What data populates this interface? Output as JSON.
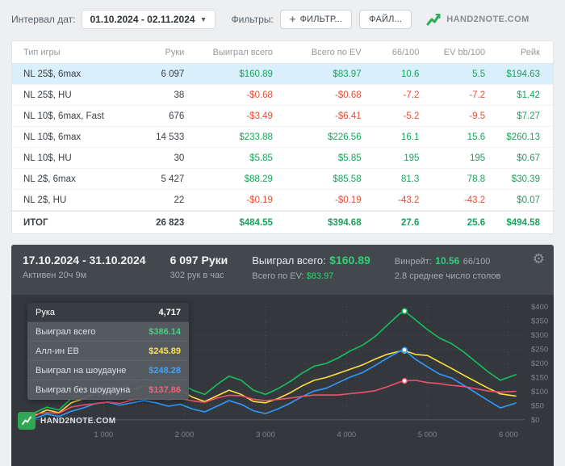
{
  "toolbar": {
    "date_label": "Интервал дат:",
    "date_value": "01.10.2024 - 02.11.2024",
    "filters_label": "Фильтры:",
    "filter_button": "ФИЛЬТР...",
    "file_button": "ФАЙЛ...",
    "brand": "HAND2NOTE.COM"
  },
  "table": {
    "headers": [
      "Тип игры",
      "Руки",
      "Выиграл всего",
      "Всего по EV",
      "66/100",
      "EV bb/100",
      "Рейк"
    ],
    "rows": [
      {
        "cells": [
          "NL 25$, 6max",
          "6 097",
          "$160.89",
          "$83.97",
          "10.6",
          "5.5",
          "$194.63"
        ],
        "selected": true,
        "total": false
      },
      {
        "cells": [
          "NL 25$, HU",
          "38",
          "-$0.68",
          "-$0.68",
          "-7.2",
          "-7.2",
          "$1.42"
        ],
        "selected": false,
        "total": false
      },
      {
        "cells": [
          "NL 10$, 6max, Fast",
          "676",
          "-$3.49",
          "-$6.41",
          "-5.2",
          "-9.5",
          "$7.27"
        ],
        "selected": false,
        "total": false
      },
      {
        "cells": [
          "NL 10$, 6max",
          "14 533",
          "$233.88",
          "$226.56",
          "16.1",
          "15.6",
          "$260.13"
        ],
        "selected": false,
        "total": false
      },
      {
        "cells": [
          "NL 10$, HU",
          "30",
          "$5.85",
          "$5.85",
          "195",
          "195",
          "$0.67"
        ],
        "selected": false,
        "total": false
      },
      {
        "cells": [
          "NL 2$, 6max",
          "5 427",
          "$88.29",
          "$85.58",
          "81.3",
          "78.8",
          "$30.39"
        ],
        "selected": false,
        "total": false
      },
      {
        "cells": [
          "NL 2$, HU",
          "22",
          "-$0.19",
          "-$0.19",
          "-43.2",
          "-43.2",
          "$0.07"
        ],
        "selected": false,
        "total": false
      },
      {
        "cells": [
          "ИТОГ",
          "26 823",
          "$484.55",
          "$394.68",
          "27.6",
          "25.6",
          "$494.58"
        ],
        "selected": false,
        "total": true
      }
    ]
  },
  "panel": {
    "date_range": "17.10.2024 - 31.10.2024",
    "active_time": "Активен 20ч 9м",
    "hands": "6 097 Руки",
    "hands_per_hour": "302 рук в час",
    "won_label": "Выиграл всего:",
    "won_value": "$160.89",
    "ev_label": "Всего по EV:",
    "ev_value": "$83.97",
    "winrate_label": "Винрейт:",
    "winrate_value": "10.56",
    "winrate_units": "66/100",
    "avg_tables": "2.8 среднее число столов",
    "watermark": "HAND2NOTE.COM",
    "tooltip": {
      "rows": [
        {
          "label": "Рука",
          "value": "4,717",
          "color": "white",
          "header": true
        },
        {
          "label": "Выиграл всего",
          "value": "$386.14",
          "color": "green"
        },
        {
          "label": "Алл-ин EВ",
          "value": "$245.89",
          "color": "yellow"
        },
        {
          "label": "Выиграл на шоудауне",
          "value": "$248.28",
          "color": "blue"
        },
        {
          "label": "Выиграл без шоудауна",
          "value": "$137.86",
          "color": "red"
        }
      ]
    }
  },
  "chart_data": {
    "type": "line",
    "title": "Выиграл всего по рукам",
    "xlabel": "Руки",
    "ylabel": "$",
    "grid": true,
    "legend_position": "tooltip-overlay",
    "xlim": [
      0,
      6200
    ],
    "ylim": [
      -15,
      415
    ],
    "x_ticks": [
      1000,
      2000,
      3000,
      4000,
      5000,
      6000
    ],
    "x_tick_labels": [
      "1 000",
      "2 000",
      "3 000",
      "4 000",
      "5 000",
      "6 000"
    ],
    "y_ticks": [
      0,
      50,
      100,
      150,
      200,
      250,
      300,
      350,
      400
    ],
    "y_tick_labels": [
      "$0",
      "$50",
      "$100",
      "$150",
      "$200",
      "$250",
      "$300",
      "$350",
      "$400"
    ],
    "marker_x": 4717,
    "x": [
      0,
      150,
      300,
      450,
      600,
      750,
      900,
      1050,
      1200,
      1350,
      1500,
      1650,
      1800,
      1950,
      2100,
      2250,
      2400,
      2550,
      2700,
      2850,
      3000,
      3150,
      3300,
      3450,
      3600,
      3750,
      3900,
      4050,
      4200,
      4350,
      4500,
      4650,
      4717,
      4850,
      5000,
      5150,
      5300,
      5450,
      5600,
      5750,
      5900,
      6097
    ],
    "series": [
      {
        "name": "Выиграл всего",
        "color": "#16c05f",
        "values": [
          0,
          25,
          45,
          35,
          75,
          95,
          115,
          125,
          110,
          130,
          145,
          135,
          120,
          130,
          105,
          90,
          125,
          155,
          140,
          105,
          90,
          110,
          135,
          165,
          190,
          200,
          220,
          245,
          265,
          295,
          335,
          375,
          386,
          355,
          320,
          290,
          270,
          240,
          205,
          170,
          140,
          161
        ]
      },
      {
        "name": "Алл-ин EВ",
        "color": "#ffdf3d",
        "values": [
          0,
          15,
          35,
          25,
          60,
          75,
          95,
          105,
          90,
          105,
          120,
          110,
          95,
          105,
          80,
          65,
          85,
          105,
          90,
          65,
          60,
          75,
          95,
          120,
          140,
          150,
          165,
          180,
          195,
          215,
          232,
          243,
          246,
          232,
          228,
          205,
          182,
          158,
          135,
          112,
          92,
          84
        ]
      },
      {
        "name": "Выиграл на шоудауне",
        "color": "#2f9bff",
        "values": [
          0,
          5,
          20,
          12,
          30,
          42,
          58,
          62,
          52,
          60,
          68,
          60,
          48,
          55,
          38,
          28,
          48,
          68,
          55,
          32,
          22,
          38,
          58,
          82,
          102,
          112,
          132,
          152,
          168,
          192,
          218,
          242,
          248,
          215,
          188,
          162,
          148,
          122,
          95,
          68,
          42,
          60
        ]
      },
      {
        "name": "Выиграл без шоудауна",
        "color": "#f0506a",
        "values": [
          0,
          20,
          25,
          23,
          45,
          53,
          57,
          63,
          58,
          70,
          77,
          75,
          72,
          75,
          67,
          62,
          77,
          87,
          85,
          73,
          68,
          72,
          77,
          83,
          88,
          88,
          88,
          93,
          97,
          103,
          117,
          133,
          138,
          140,
          132,
          128,
          122,
          118,
          110,
          102,
          98,
          101
        ]
      }
    ]
  }
}
